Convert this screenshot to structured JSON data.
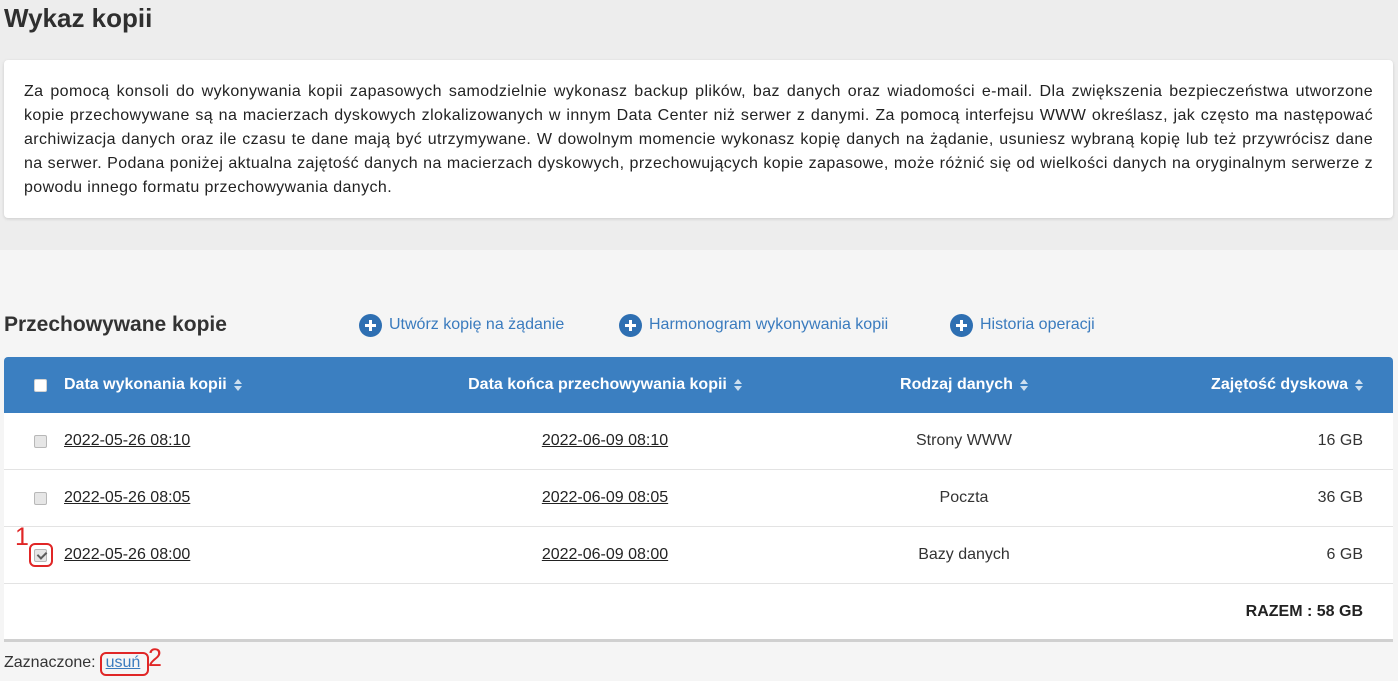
{
  "page": {
    "title": "Wykaz kopii"
  },
  "info": {
    "text": "Za pomocą konsoli do wykonywania kopii zapasowych samodzielnie wykonasz backup plików, baz danych oraz wiadomości e-mail. Dla zwiększenia bezpieczeństwa utworzone kopie przechowywane są na macierzach dyskowych zlokalizowanych w innym Data Center niż serwer z danymi. Za pomocą interfejsu WWW określasz, jak często ma następować archiwizacja danych oraz ile czasu te dane mają być utrzymywane. W dowolnym momencie wykonasz kopię danych na żądanie, usuniesz wybraną kopię lub też przywrócisz dane na serwer. Podana poniżej aktualna zajętość danych na macierzach dyskowych, przechowujących kopie zapasowe, może różnić się od wielkości danych na oryginalnym serwerze z powodu innego formatu przechowywania danych."
  },
  "backups": {
    "heading": "Przechowywane kopie",
    "actions": [
      {
        "label": "Utwórz kopię na żądanie",
        "icon": "plus-circle-icon"
      },
      {
        "label": "Harmonogram wykonywania kopii",
        "icon": "plus-circle-icon"
      },
      {
        "label": "Historia operacji",
        "icon": "plus-circle-icon"
      }
    ],
    "table": {
      "select_all_checked": false,
      "columns": [
        {
          "label": "Data wykonania kopii",
          "icon": "sort-icon"
        },
        {
          "label": "Data końca przechowywania kopii",
          "icon": "sort-icon"
        },
        {
          "label": "Rodzaj danych",
          "icon": "sort-icon"
        },
        {
          "label": "Zajętość dyskowa",
          "icon": "sort-icon"
        }
      ],
      "rows": [
        {
          "checked": false,
          "created": "2022-05-26 08:10",
          "expires": "2022-06-09 08:10",
          "type": "Strony WWW",
          "size": "16 GB"
        },
        {
          "checked": false,
          "created": "2022-05-26 08:05",
          "expires": "2022-06-09 08:05",
          "type": "Poczta",
          "size": "36 GB"
        },
        {
          "checked": true,
          "created": "2022-05-26 08:00",
          "expires": "2022-06-09 08:00",
          "type": "Bazy danych",
          "size": "6 GB"
        }
      ],
      "total": "RAZEM : 58 GB"
    }
  },
  "selection": {
    "label": "Zaznaczone:",
    "delete_link": "usuń"
  },
  "annotations": [
    {
      "label": "1"
    },
    {
      "label": "2"
    }
  ],
  "colors": {
    "header_bg": "#3b7fc1",
    "link": "#3a7bbe",
    "icon": "#2e6fb2",
    "annotation": "#e02626",
    "page_bg_top": "#ededed",
    "page_bg": "#f5f5f5"
  }
}
